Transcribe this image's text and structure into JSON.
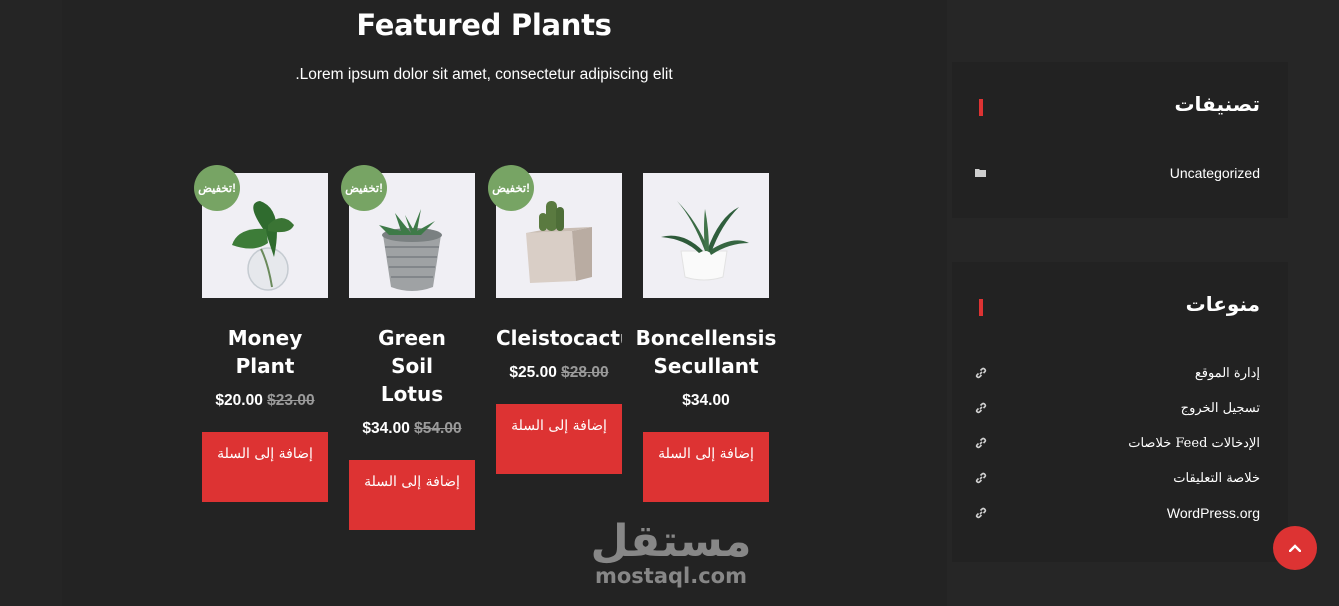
{
  "section": {
    "title": "Featured Plants",
    "subtitle": ".Lorem ipsum dolor sit amet, consectetur adipiscing elit"
  },
  "products": [
    {
      "name": "Money Plant",
      "badge": "تخفيض!",
      "price": "$20.00",
      "old_price": "$23.00",
      "button": "إضافة إلى السلة"
    },
    {
      "name": "Green Soil Lotus",
      "badge": "تخفيض!",
      "price": "$34.00",
      "old_price": "$54.00",
      "button": "إضافة إلى السلة"
    },
    {
      "name": "Cleistocactus",
      "badge": "تخفيض!",
      "price": "$25.00",
      "old_price": "$28.00",
      "button": "إضافة إلى السلة"
    },
    {
      "name": "Boncellensis Secullant",
      "badge": "",
      "price": "$34.00",
      "old_price": "",
      "button": "إضافة إلى السلة"
    }
  ],
  "sidebar": {
    "categories": {
      "title": "تصنيفات",
      "items": [
        {
          "label": "Uncategorized",
          "icon": "folder-icon"
        }
      ]
    },
    "meta": {
      "title": "منوعات",
      "items": [
        {
          "label": "إدارة الموقع",
          "icon": "link-icon"
        },
        {
          "label": "تسجيل الخروج",
          "icon": "link-icon"
        },
        {
          "label": "خلاصات Feed الإدخالات",
          "icon": "link-icon"
        },
        {
          "label": "خلاصة التعليقات",
          "icon": "link-icon"
        },
        {
          "label": "WordPress.org",
          "icon": "link-icon"
        }
      ]
    }
  },
  "watermark": {
    "arabic": "مستقل",
    "latin": "mostaql.com"
  },
  "colors": {
    "accent": "#dd3333",
    "sale_badge": "#77a464",
    "background": "#232323"
  }
}
